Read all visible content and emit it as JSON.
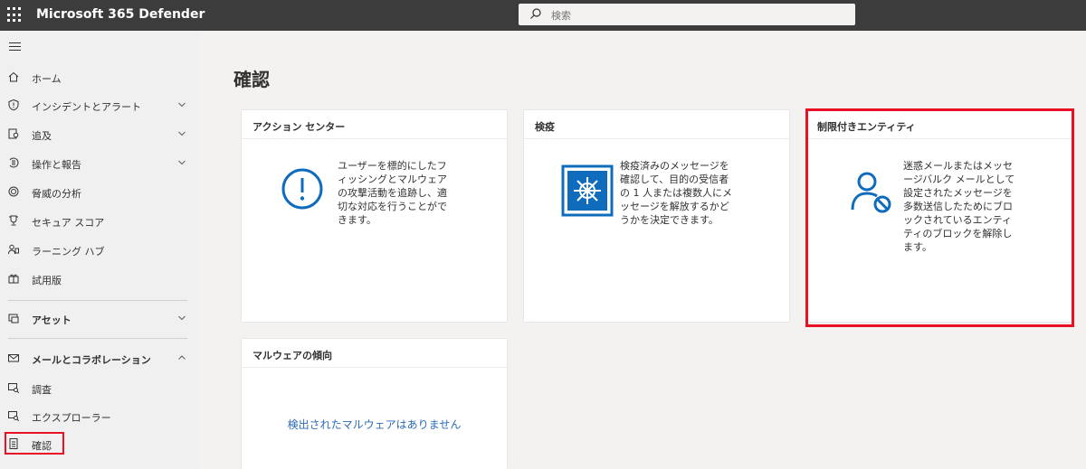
{
  "app": {
    "title": "Microsoft 365 Defender"
  },
  "search": {
    "placeholder": "検索"
  },
  "sidebar": {
    "items": [
      {
        "label": "ホーム"
      },
      {
        "label": "インシデントとアラート"
      },
      {
        "label": "追及"
      },
      {
        "label": "操作と報告"
      },
      {
        "label": "脅威の分析"
      },
      {
        "label": "セキュア スコア"
      },
      {
        "label": "ラーニング ハブ"
      },
      {
        "label": "試用版"
      },
      {
        "label": "アセット"
      },
      {
        "label": "メールとコラボレーション"
      },
      {
        "label": "調査"
      },
      {
        "label": "エクスプローラー"
      },
      {
        "label": "確認"
      }
    ]
  },
  "main": {
    "title": "確認",
    "cards": [
      {
        "title": "アクション センター",
        "text": "ユーザーを標的にしたフィッシングとマルウェアの攻撃活動を追跡し、適切な対応を行うことができます。"
      },
      {
        "title": "検疫",
        "text": "検疫済みのメッセージを確認して、目的の受信者の 1 人または複数人にメッセージを解放するかどうかを決定できます。"
      },
      {
        "title": "制限付きエンティティ",
        "text": "迷惑メールまたはメッセージバルク メールとして設定されたメッセージを多数送信したためにブロックされているエンティティのブロックを解除します。"
      },
      {
        "title": "マルウェアの傾向",
        "empty": "検出されたマルウェアはありません"
      }
    ]
  },
  "colors": {
    "topbar": "#3c3c3c",
    "accent": "#0f6cbd",
    "highlight": "#e81123"
  },
  "icons": [
    "waffle-icon",
    "search-icon",
    "hamburger-icon",
    "home-icon",
    "shield-icon",
    "hunting-icon",
    "actions-icon",
    "threat-icon",
    "trophy-icon",
    "learning-icon",
    "trial-icon",
    "assets-icon",
    "mail-icon",
    "investigate-icon",
    "explorer-icon",
    "review-icon",
    "alert-circle-icon",
    "quarantine-icon",
    "restricted-user-icon"
  ]
}
